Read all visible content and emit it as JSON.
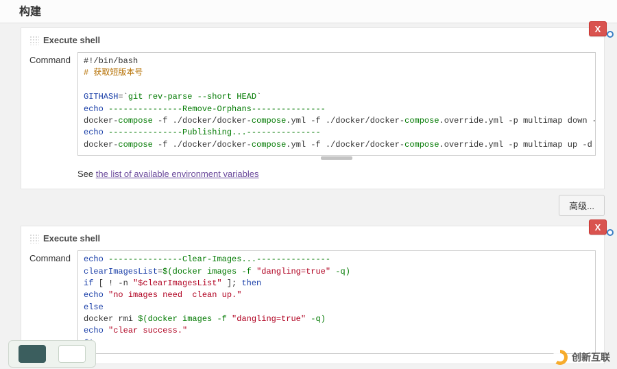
{
  "section_title": "构建",
  "close_glyph": "X",
  "advanced_btn": "高级...",
  "helper": {
    "prefix": "See ",
    "link": "the list of available environment variables"
  },
  "labels": {
    "step_title": "Execute shell",
    "command": "Command"
  },
  "logo_text": "创新互联",
  "code1": {
    "l1": "#!/bin/bash",
    "l2": "# 获取短版本号",
    "l3a": "GITHASH",
    "l3b": "=`",
    "l3c": "git rev-parse --short HEAD",
    "l3d": "`",
    "l4a": "echo",
    "l4b": " ---------------Remove-Orphans---------------",
    "l5a": "docker-",
    "l5b": "compose",
    "l5c": " -f ./docker/docker-",
    "l5d": "compose",
    "l5e": ".yml -f ./docker/docker-",
    "l5f": "compose",
    "l5g": ".override.yml -p multimap down --rmi local ",
    "l6a": "echo",
    "l6b": " ---------------Publishing...---------------",
    "l7a": "docker-",
    "l7b": "compose",
    "l7c": " -f ./docker/docker-",
    "l7d": "compose",
    "l7e": ".yml -f ./docker/docker-",
    "l7f": "compose",
    "l7g": ".override.yml -p multimap up -d --build"
  },
  "code2": {
    "l1a": "echo",
    "l1b": " ---------------Clear-Images...---------------",
    "l2a": "clearImagesList",
    "l2b": "=",
    "l2c": "$(",
    "l2d": "docker images -f ",
    "l2e": "\"dangling=true\"",
    "l2f": " -q",
    "l2g": ")",
    "l3a": "if",
    "l3b": " [ ! -n ",
    "l3c": "\"$clearImagesList\"",
    "l3d": " ]; ",
    "l3e": "then",
    "l4a": "echo",
    "l4b": " \"no images need  clean up.\"",
    "l5": "else",
    "l6a": "docker rmi ",
    "l6b": "$(",
    "l6c": "docker images -f ",
    "l6d": "\"dangling=true\"",
    "l6e": " -q",
    "l6f": ")",
    "l7a": "echo",
    "l7b": " \"clear success.\"",
    "l8": "fi"
  }
}
